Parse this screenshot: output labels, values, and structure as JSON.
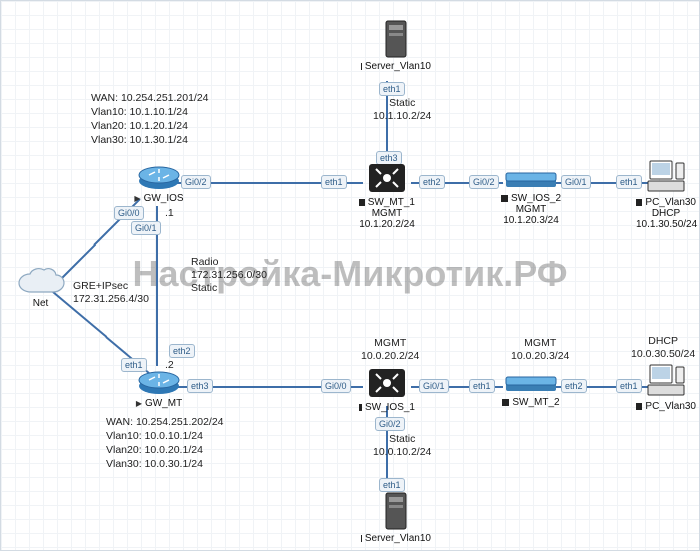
{
  "watermark": "Настройка-Микротик.РФ",
  "cloud": {
    "label": "Net"
  },
  "gre": {
    "l1": "GRE+IPsec",
    "l2": "172.31.256.4/30"
  },
  "radio": {
    "l1": "Radio",
    "l2": "172.31.256.0/30",
    "l3": "Static"
  },
  "gw_ios": {
    "name": "GW_IOS",
    "wan": "WAN: 10.254.251.201/24",
    "v10": "Vlan10: 10.1.10.1/24",
    "v20": "Vlan20: 10.1.20.1/24",
    "v30": "Vlan30: 10.1.30.1/24",
    "dot": ".1"
  },
  "gw_mt": {
    "name": "GW_MT",
    "wan": "WAN: 10.254.251.202/24",
    "v10": "Vlan10: 10.0.10.1/24",
    "v20": "Vlan20: 10.0.20.1/24",
    "v30": "Vlan30: 10.0.30.1/24",
    "dot": ".2"
  },
  "sw_mt_1": {
    "name": "SW_MT_1",
    "mgmt": "MGMT",
    "ip": "10.1.20.2/24"
  },
  "sw_ios_2": {
    "name": "SW_IOS_2",
    "mgmt": "MGMT",
    "ip": "10.1.20.3/24"
  },
  "sw_ios_1": {
    "name": "SW_IOS_1",
    "mgmt": "MGMT",
    "ip": "10.0.20.2/24"
  },
  "sw_mt_2": {
    "name": "SW_MT_2",
    "mgmt": "MGMT",
    "ip": "10.0.20.3/24"
  },
  "server_top": {
    "name": "Server_Vlan10",
    "static": "Static",
    "ip": "10.1.10.2/24"
  },
  "server_bot": {
    "name": "Server_Vlan10",
    "static": "Static",
    "ip": "10.0.10.2/24"
  },
  "pc_top": {
    "name": "PC_Vlan30",
    "dhcp": "DHCP",
    "ip": "10.1.30.50/24"
  },
  "pc_bot": {
    "name": "PC_Vlan30",
    "dhcp": "DHCP",
    "ip": "10.0.30.50/24"
  },
  "if": {
    "gi00": "Gi0/0",
    "gi01": "Gi0/1",
    "gi02": "Gi0/2",
    "eth1": "eth1",
    "eth2": "eth2",
    "eth3": "eth3"
  }
}
